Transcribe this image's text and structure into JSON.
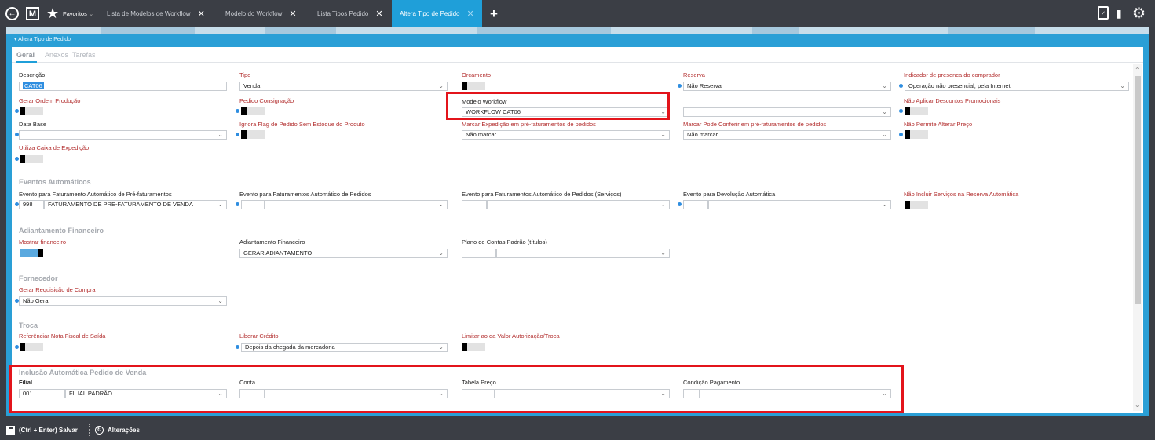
{
  "topbar": {
    "favorites_label": "Favoritos",
    "tabs": [
      {
        "label": "Lista de Modelos de Workflow"
      },
      {
        "label": "Modelo do Workflow"
      },
      {
        "label": "Lista Tipos Pedido"
      },
      {
        "label": "Altera Tipo de Pedido"
      }
    ],
    "brand_letter": "M"
  },
  "panel": {
    "title": "Altera Tipo de Pedido",
    "subtabs": [
      "Geral",
      "Anexos",
      "Tarefas"
    ]
  },
  "fields": {
    "descricao": {
      "label": "Descrição",
      "value": "CAT06"
    },
    "tipo": {
      "label": "Tipo",
      "value": "Venda"
    },
    "orcamento": {
      "label": "Orcamento"
    },
    "reserva": {
      "label": "Reserva",
      "value": "Não Reservar"
    },
    "indicador": {
      "label": "Indicador de presenca do comprador",
      "value": "Operação não presencial, pela Internet"
    },
    "gerar_ordem": {
      "label": "Gerar Ordem Produção"
    },
    "pedido_consig": {
      "label": "Pedido Consignação"
    },
    "modelo_workflow": {
      "label": "Modelo Workflow",
      "value": "WORKFLOW CAT06"
    },
    "nao_aplicar": {
      "label": "Não Aplicar Descontos Promocionais"
    },
    "data_base": {
      "label": "Data Base"
    },
    "ignora_flag": {
      "label": "Ignora Flag de Pedido Sem Estoque do Produto"
    },
    "marcar_exped": {
      "label": "Marcar Expedição em pré-faturamentos de pedidos",
      "value": "Não marcar"
    },
    "marcar_conferir": {
      "label": "Marcar Pode Conferir em pré-faturamentos de pedidos",
      "value": "Não marcar"
    },
    "nao_permite": {
      "label": "Não Permite Alterar Preço"
    },
    "utiliza_caixa": {
      "label": "Utiliza Caixa de Expedição"
    }
  },
  "eventos": {
    "title": "Eventos Automáticos",
    "ev1": {
      "label": "Evento para Faturamento Automático de Pré-faturamentos",
      "code": "998",
      "value": "FATURAMENTO DE PRE-FATURAMENTO DE VENDA"
    },
    "ev2": {
      "label": "Evento para Faturamentos Automático de Pedidos"
    },
    "ev3": {
      "label": "Evento para Faturamentos Automático de Pedidos (Serviços)"
    },
    "ev4": {
      "label": "Evento para Devolução Automática"
    },
    "ev5": {
      "label": "Não Incluir Serviços na Reserva Automática"
    }
  },
  "adiantamento": {
    "title": "Adiantamento Financeiro",
    "mostrar": {
      "label": "Mostrar financeiro"
    },
    "adiant": {
      "label": "Adiantamento Financeiro",
      "value": "GERAR ADIANTAMENTO"
    },
    "plano": {
      "label": "Plano de Contas  Padrão (títulos)"
    }
  },
  "fornecedor": {
    "title": "Fornecedor",
    "gerar_req": {
      "label": "Gerar Requisição de Compra",
      "value": "Não Gerar"
    }
  },
  "troca": {
    "title": "Troca",
    "referenciar": {
      "label": "Referênciar Nota Fiscal de Saída"
    },
    "liberar": {
      "label": "Liberar Crédito",
      "value": "Depois da chegada da mercadoria"
    },
    "limitar": {
      "label": "Limitar ao da Valor Autorização/Troca"
    }
  },
  "inclusao": {
    "title": "Inclusão Automática Pedido de Venda",
    "filial": {
      "label": "Filial",
      "code": "001",
      "value": "FILIAL PADRÃO"
    },
    "conta": {
      "label": "Conta"
    },
    "tabela": {
      "label": "Tabela Preço"
    },
    "condicao": {
      "label": "Condição Pagamento"
    }
  },
  "bottombar": {
    "save_label": "(Ctrl + Enter) Salvar",
    "changes_label": "Alterações"
  },
  "colors": {
    "accent": "#2a9fd6",
    "highlight_border": "#e3141b",
    "required_label": "#b22d2d"
  }
}
